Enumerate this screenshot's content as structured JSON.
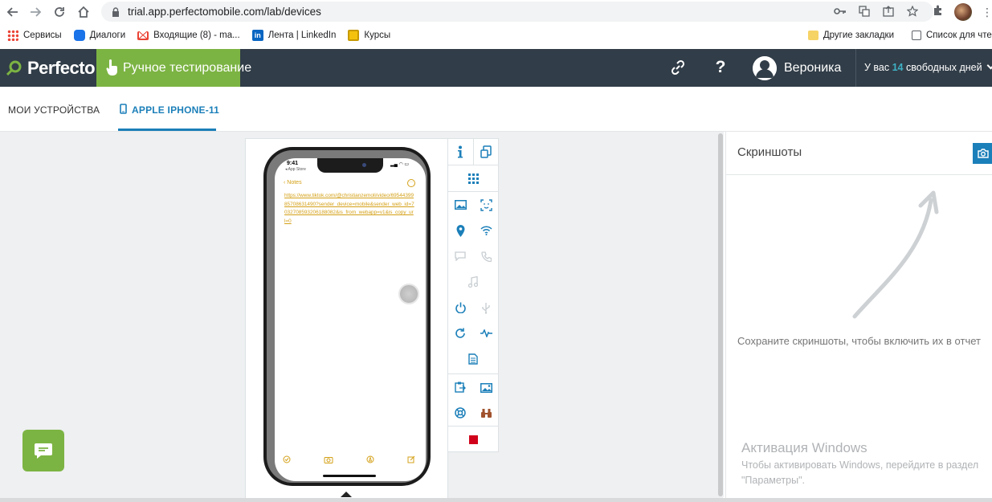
{
  "browser": {
    "url": "trial.app.perfectomobile.com/lab/devices",
    "bookmarks": [
      {
        "label": "Сервисы",
        "icon": "apps-grid-icon"
      },
      {
        "label": "Диалоги",
        "icon": "chat-bubble-icon"
      },
      {
        "label": "Входящие (8) - ma...",
        "icon": "gmail-icon"
      },
      {
        "label": "Лента | LinkedIn",
        "icon": "linkedin-icon"
      },
      {
        "label": "Курсы",
        "icon": "courses-icon"
      }
    ],
    "other_bookmarks": "Другие закладки",
    "reading_list": "Список для чтения"
  },
  "app": {
    "logo": "Perfecto",
    "mode": "Ручное тестирование",
    "help": "?",
    "user": "Вероника",
    "trial_prefix": "У вас",
    "trial_days": "14",
    "trial_suffix": "свободных дней"
  },
  "tabs": [
    {
      "label": "МОИ УСТРОЙСТВА",
      "active": false
    },
    {
      "label": "APPLE IPHONE-11",
      "active": true
    }
  ],
  "device": {
    "time": "9:41",
    "back_app": "◂ App Store",
    "notes_back": "Notes",
    "note_text": "https://www.tiktok.com/@christianzemoli/video/6954439985708631490?sender_device=mobile&sender_web_id=7032708593206188082&is_from_webapp=v1&is_copy_url=0"
  },
  "screenshots_panel": {
    "title": "Скриншоты",
    "message": "Сохраните скриншоты, чтобы включить их в отчет"
  },
  "watermark": {
    "title": "Активация Windows",
    "text": "Чтобы активировать Windows, перейдите в раздел \"Параметры\"."
  },
  "colors": {
    "green": "#7cb443",
    "navbar": "#313d48",
    "accent": "#1b7fb9",
    "stop": "#d0021b"
  }
}
